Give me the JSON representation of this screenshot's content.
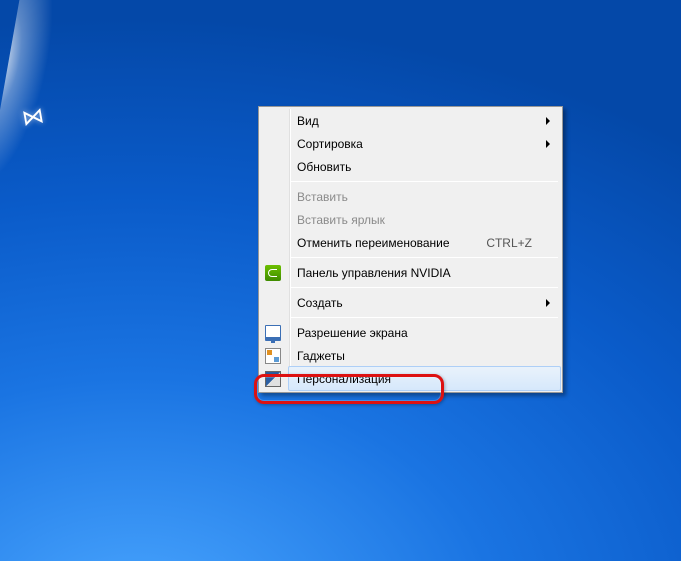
{
  "menu": {
    "view": {
      "label": "Вид"
    },
    "sort": {
      "label": "Сортировка"
    },
    "refresh": {
      "label": "Обновить"
    },
    "paste": {
      "label": "Вставить"
    },
    "paste_shortcut": {
      "label": "Вставить ярлык"
    },
    "undo_rename": {
      "label": "Отменить переименование",
      "shortcut": "CTRL+Z"
    },
    "nvidia": {
      "label": "Панель управления NVIDIA"
    },
    "new": {
      "label": "Создать"
    },
    "resolution": {
      "label": "Разрешение экрана"
    },
    "gadgets": {
      "label": "Гаджеты"
    },
    "personalize": {
      "label": "Персонализация"
    }
  }
}
